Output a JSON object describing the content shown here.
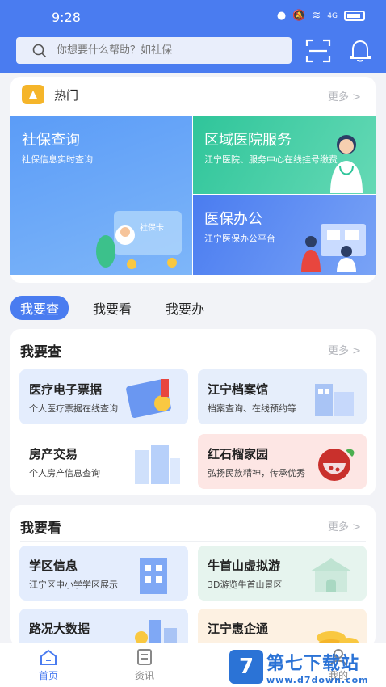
{
  "status": {
    "time": "9:28",
    "signal": "4G"
  },
  "search": {
    "placeholder": "你想要什么帮助？如社保"
  },
  "hot": {
    "title": "热门",
    "more": "更多 >",
    "tiles": [
      {
        "title": "社保查询",
        "sub": "社保信息实时查询",
        "badge": "社保卡"
      },
      {
        "title": "区域医院服务",
        "sub": "江宁医院、服务中心在线挂号缴费"
      },
      {
        "title": "医保办公",
        "sub": "江宁医保办公平台"
      }
    ]
  },
  "tabs": [
    {
      "label": "我要查"
    },
    {
      "label": "我要看"
    },
    {
      "label": "我要办"
    }
  ],
  "sections": [
    {
      "title": "我要查",
      "more": "更多 >",
      "items": [
        {
          "title": "医疗电子票据",
          "sub": "个人医疗票据在线查询"
        },
        {
          "title": "江宁档案馆",
          "sub": "档案查询、在线预约等"
        },
        {
          "title": "房产交易",
          "sub": "个人房产信息查询"
        },
        {
          "title": "红石榴家园",
          "sub": "弘扬民族精神，传承优秀"
        }
      ]
    },
    {
      "title": "我要看",
      "more": "更多 >",
      "items": [
        {
          "title": "学区信息",
          "sub": "江宁区中小学学区展示"
        },
        {
          "title": "牛首山虚拟游",
          "sub": "3D游览牛首山景区"
        },
        {
          "title": "路况大数据",
          "sub": ""
        },
        {
          "title": "江宁惠企通",
          "sub": ""
        }
      ]
    }
  ],
  "nav": [
    {
      "label": "首页"
    },
    {
      "label": "资讯"
    },
    {
      "label": "我的"
    }
  ],
  "watermark": {
    "logo": "7",
    "main": "第七下载站",
    "url": "www.d7down.com"
  },
  "colors": {
    "primary": "#4a7cf0",
    "hot_icon": "#f5b52a",
    "hospital_tile": "#2fc59a"
  }
}
